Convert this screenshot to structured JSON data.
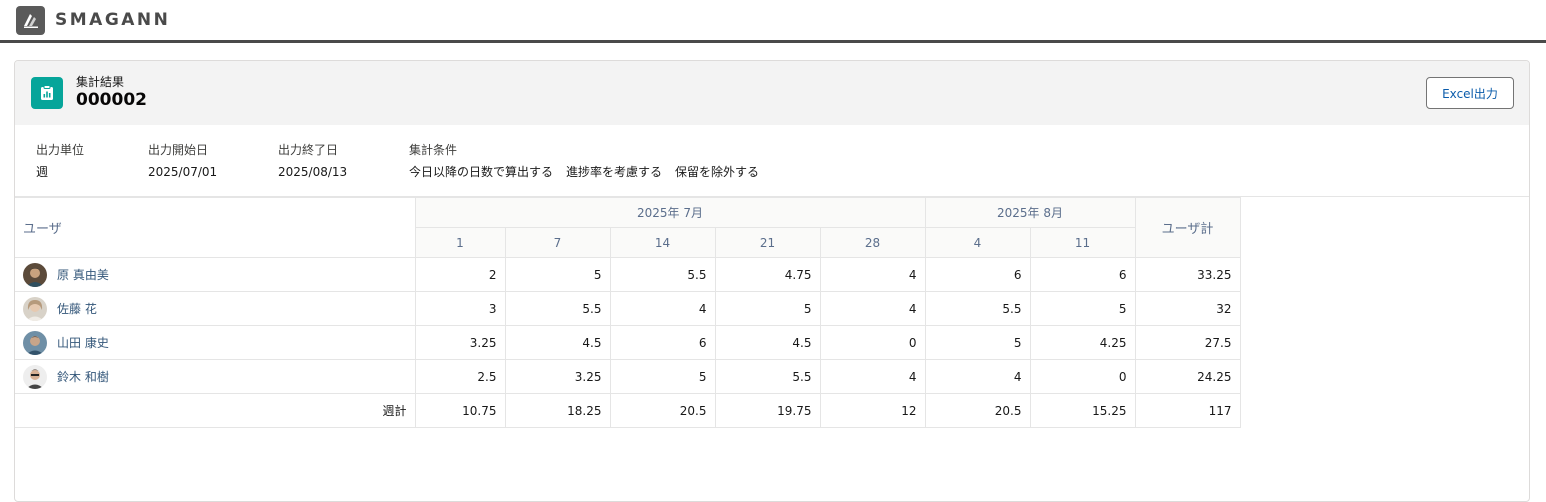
{
  "app": {
    "brand": "SMAGANN"
  },
  "header": {
    "subtitle": "集計結果",
    "title": "000002",
    "excel_button": "Excel出力"
  },
  "meta": {
    "unit_label": "出力単位",
    "unit_value": "週",
    "start_label": "出力開始日",
    "start_value": "2025/07/01",
    "end_label": "出力終了日",
    "end_value": "2025/08/13",
    "conditions_label": "集計条件",
    "conditions": [
      "今日以降の日数で算出する",
      "進捗率を考慮する",
      "保留を除外する"
    ]
  },
  "table": {
    "user_header": "ユーザ",
    "total_header": "ユーザ計",
    "months": [
      {
        "label": "2025年 7月",
        "span": 5
      },
      {
        "label": "2025年 8月",
        "span": 2
      }
    ],
    "weeks": [
      "1",
      "7",
      "14",
      "21",
      "28",
      "4",
      "11"
    ],
    "rows": [
      {
        "name": "原 真由美",
        "values": [
          "2",
          "5",
          "5.5",
          "4.75",
          "4",
          "6",
          "6"
        ],
        "total": "33.25"
      },
      {
        "name": "佐藤 花",
        "values": [
          "3",
          "5.5",
          "4",
          "5",
          "4",
          "5.5",
          "5"
        ],
        "total": "32"
      },
      {
        "name": "山田 康史",
        "values": [
          "3.25",
          "4.5",
          "6",
          "4.5",
          "0",
          "5",
          "4.25"
        ],
        "total": "27.5"
      },
      {
        "name": "鈴木 和樹",
        "values": [
          "2.5",
          "3.25",
          "5",
          "5.5",
          "4",
          "4",
          "0"
        ],
        "total": "24.25"
      }
    ],
    "week_total_label": "週計",
    "week_totals": [
      "10.75",
      "18.25",
      "20.5",
      "19.75",
      "12",
      "20.5",
      "15.25"
    ],
    "grand_total": "117"
  },
  "colors": {
    "accent": "#06a59a",
    "link": "#34577a",
    "header_text": "#5b6e8c"
  }
}
